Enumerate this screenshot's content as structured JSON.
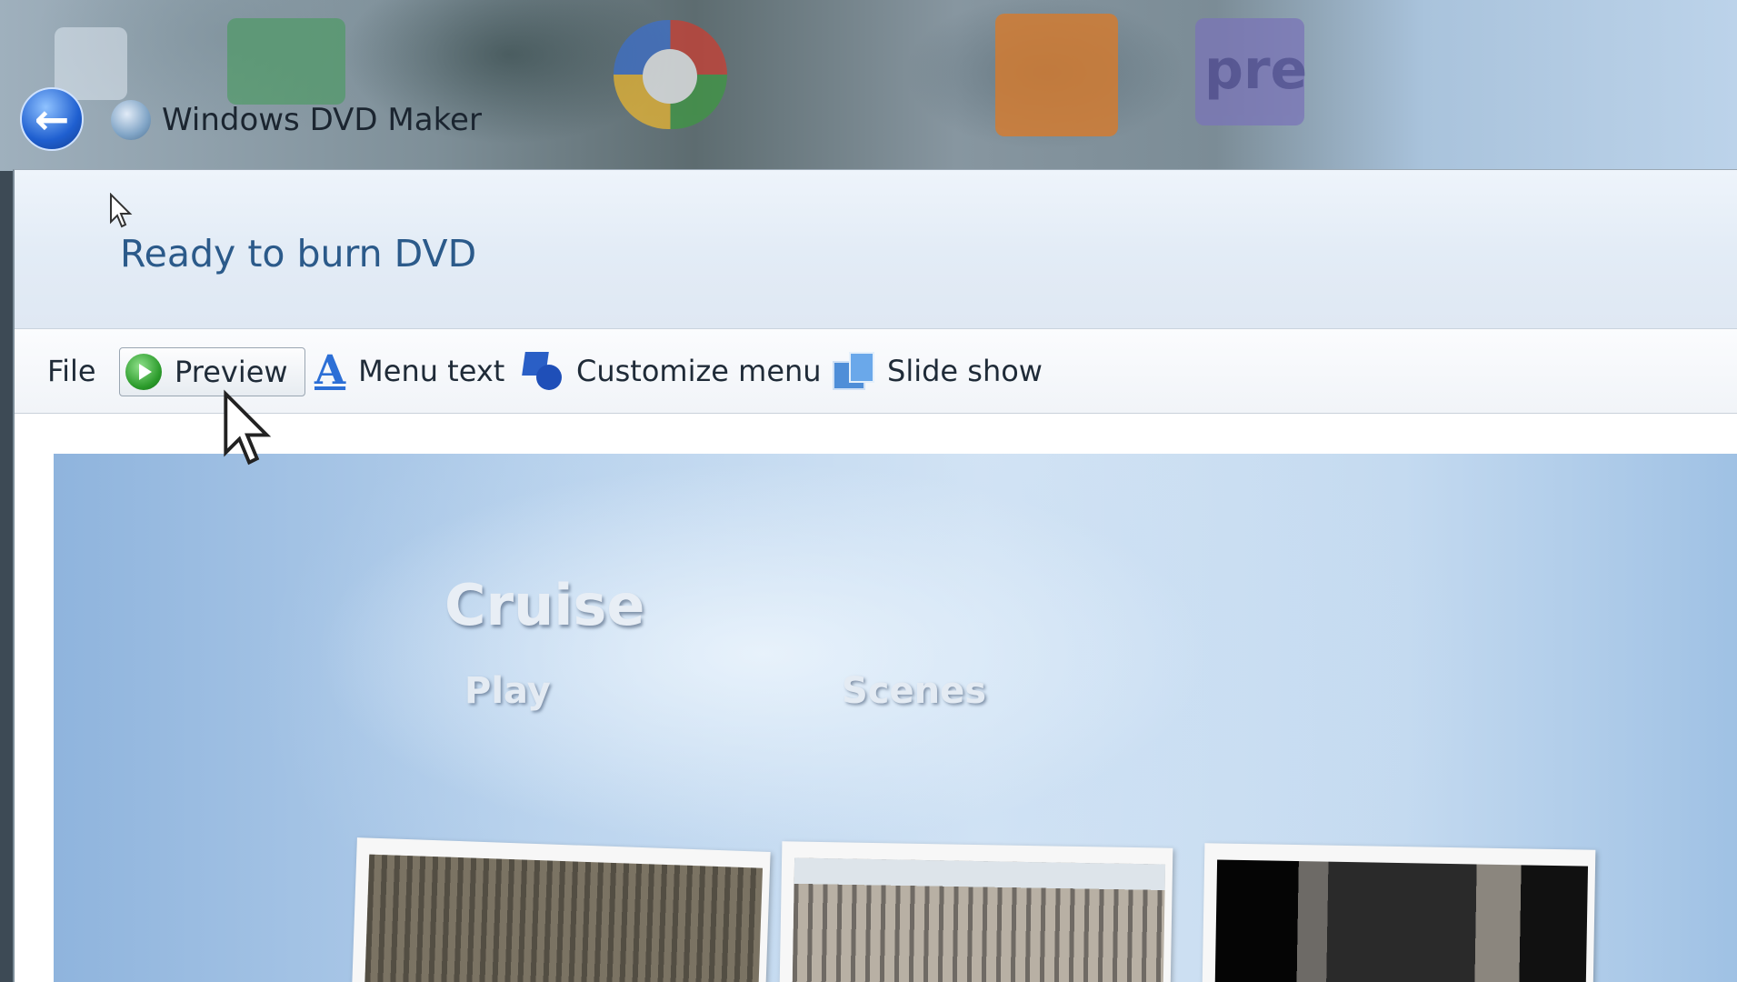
{
  "titlebar": {
    "app_title": "Windows DVD Maker",
    "desktop_icons": [
      "spreadsheet-icon",
      "picasa-icon",
      "xampp-icon",
      "premiere-icon"
    ],
    "premiere_label": "pre"
  },
  "header": {
    "title": "Ready to burn DVD"
  },
  "toolbar": {
    "file_label": "File",
    "preview_label": "Preview",
    "menu_text_label": "Menu text",
    "customize_menu_label": "Customize menu",
    "slide_show_label": "Slide show"
  },
  "dvd_menu": {
    "title": "Cruise",
    "play_label": "Play",
    "scenes_label": "Scenes",
    "thumbnails": [
      "thumbnail-1",
      "thumbnail-2",
      "thumbnail-3"
    ]
  },
  "colors": {
    "header_title": "#2b5a8a",
    "accent_blue": "#2c6fd6",
    "play_green": "#2a9a2a"
  }
}
